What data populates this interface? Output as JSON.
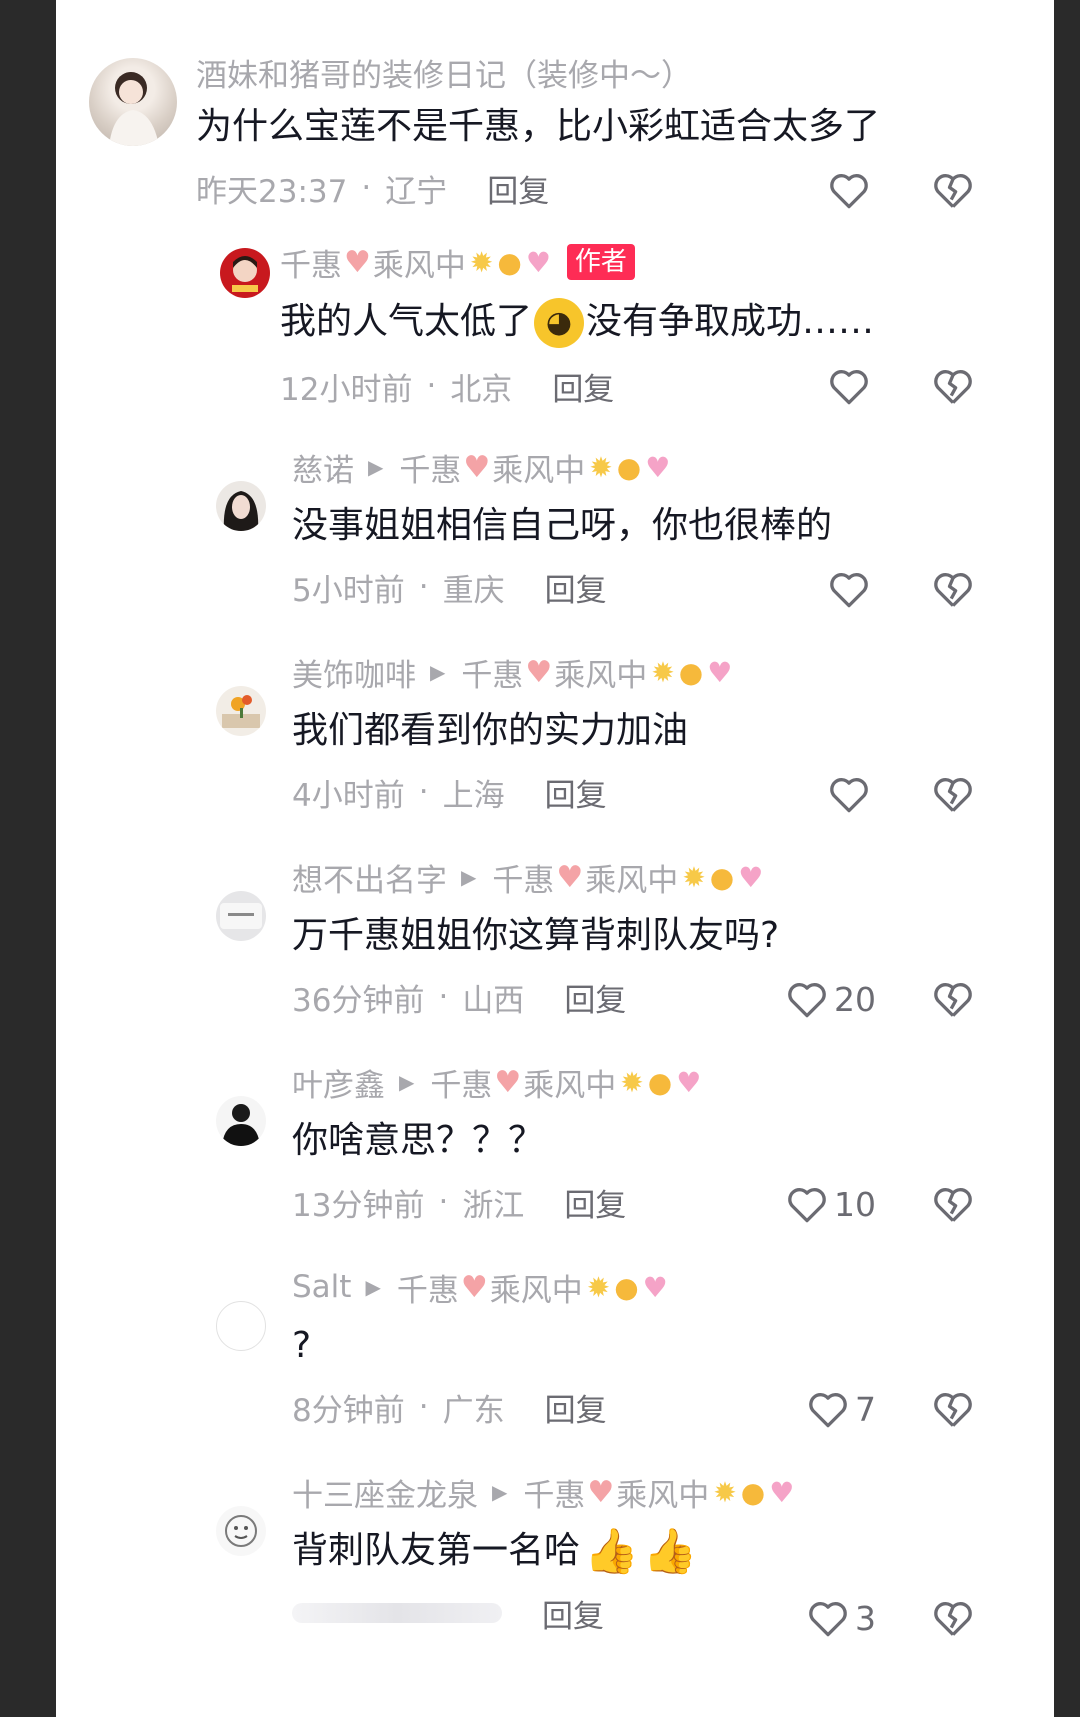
{
  "comments": [
    {
      "user": "酒妹和猪哥的装修日记（装修中～）",
      "text": "为什么宝莲不是千惠，比小彩虹适合太多了",
      "time": "昨天23:37",
      "location": "辽宁",
      "reply": "回复",
      "likes": ""
    },
    {
      "user": "千惠",
      "user_suffix": "乘风中",
      "badge": "作者",
      "text_before": "我的人气太低了",
      "text_after": "没有争取成功……",
      "time": "12小时前",
      "location": "北京",
      "reply": "回复",
      "likes": ""
    },
    {
      "user": "慈诺",
      "reply_to": "千惠",
      "reply_to_suffix": "乘风中",
      "text": "没事姐姐相信自己呀，你也很棒的",
      "time": "5小时前",
      "location": "重庆",
      "reply": "回复",
      "likes": ""
    },
    {
      "user": "美饰咖啡",
      "reply_to": "千惠",
      "reply_to_suffix": "乘风中",
      "text": "我们都看到你的实力加油",
      "time": "4小时前",
      "location": "上海",
      "reply": "回复",
      "likes": ""
    },
    {
      "user": "想不出名字",
      "reply_to": "千惠",
      "reply_to_suffix": "乘风中",
      "text": "万千惠姐姐你这算背刺队友吗?",
      "time": "36分钟前",
      "location": "山西",
      "reply": "回复",
      "likes": "20"
    },
    {
      "user": "叶彦鑫",
      "reply_to": "千惠",
      "reply_to_suffix": "乘风中",
      "text": "你啥意思？？？",
      "time": "13分钟前",
      "location": "浙江",
      "reply": "回复",
      "likes": "10"
    },
    {
      "user": "Salt",
      "reply_to": "千惠",
      "reply_to_suffix": "乘风中",
      "text": "?",
      "time": "8分钟前",
      "location": "广东",
      "reply": "回复",
      "likes": "7"
    },
    {
      "user": "十三座金龙泉",
      "reply_to": "千惠",
      "reply_to_suffix": "乘风中",
      "text": "背刺队友第一名哈",
      "time": "",
      "location": "",
      "reply": "回复",
      "likes": "3"
    }
  ],
  "icons": {
    "reply_arrow": "play-triangle-icon",
    "name_heart": "pink-heart-icon",
    "like": "heart-outline-icon",
    "dislike": "broken-heart-icon",
    "crying_emoji": "crying-face-emoji",
    "thumbs_up": "thumbs-up-emoji"
  },
  "colors": {
    "background": "#ffffff",
    "author_badge": "#fe2c55",
    "secondary_text": "#a8a8ad",
    "pink_heart": "#f4a3a6"
  }
}
